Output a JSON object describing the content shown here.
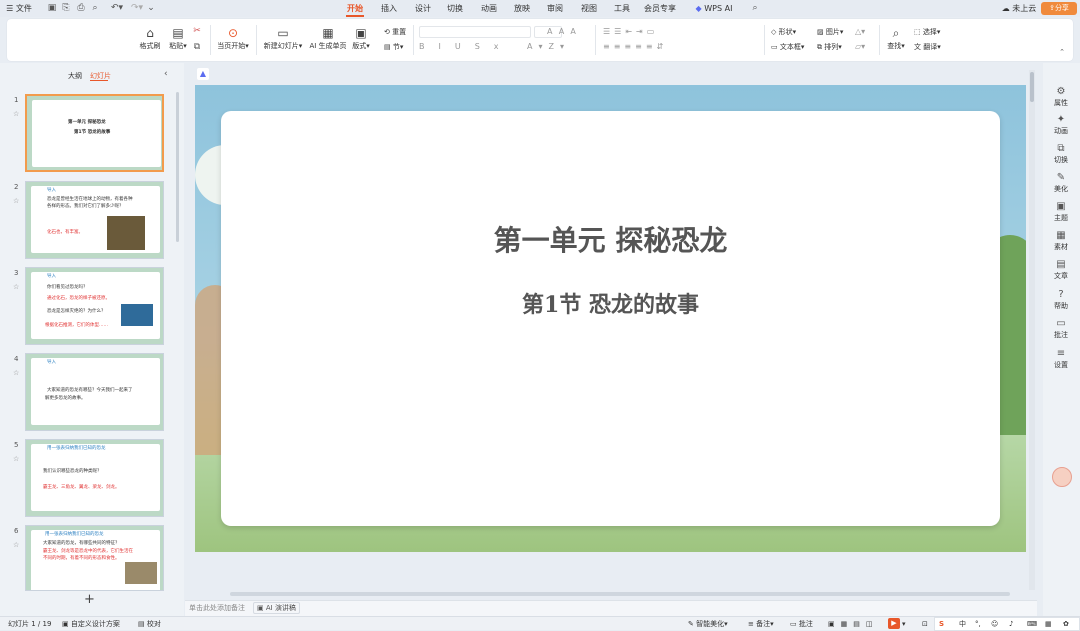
{
  "topbar": {
    "file": "文件",
    "tabs": [
      "开始",
      "插入",
      "设计",
      "切换",
      "动画",
      "放映",
      "审阅",
      "视图",
      "工具",
      "会员专享"
    ],
    "wps_ai": "WPS AI",
    "cloud": "未上云",
    "share": "分享"
  },
  "ribbon": {
    "format_painter": "格式刷",
    "paste": "粘贴",
    "from_current": "当页开始",
    "new_slide": "新建幻灯片",
    "ai_generate": "AI 生成单页",
    "layout": "版式",
    "reset": "重置",
    "section": "节",
    "shape": "形状",
    "picture": "图片",
    "textbox": "文本框",
    "arrange": "排列",
    "find": "查找",
    "select": "选择",
    "translate": "翻译"
  },
  "leftpanel": {
    "tab_outline": "大纲",
    "tab_slides": "幻灯片",
    "thumbnails": [
      {
        "num": "1",
        "lines": [
          "第一单元  探秘恐龙",
          "第1节  恐龙的故事"
        ]
      },
      {
        "num": "2",
        "lines": [
          "导入",
          "恐龙是曾经生活在地球上的动物，有着各种",
          "各样的形态。我们对它们了解多少呢？",
          "",
          "化石也，有丰富。"
        ]
      },
      {
        "num": "3",
        "lines": [
          "导入",
          "你们看见过恐龙吗？",
          "通过化石，恐龙的样子被还原。",
          "恐龙是怎样灭绝的？为什么？",
          "根据化石推测，它们的体型……"
        ]
      },
      {
        "num": "4",
        "lines": [
          "导入",
          "",
          "大家知道的恐龙有哪些？今天我们一起来了",
          "解更多恐龙的故事。"
        ]
      },
      {
        "num": "5",
        "lines": [
          "用一张表归纳我们已知的恐龙",
          "",
          "我们认识哪些恐龙的种类呢？",
          "霸王龙、三角龙、翼龙、梁龙、剑龙。"
        ]
      },
      {
        "num": "6",
        "lines": [
          "用一张表归纳我们已知的恐龙",
          "大家知道的恐龙，有哪些共同的特征？",
          "霸王龙、剑龙等是恐龙中的代表，它们生活在",
          "不同的时期，有着不同的形态和食性。"
        ]
      }
    ],
    "add": "+"
  },
  "slide": {
    "title": "第一单元  探秘恐龙",
    "subtitle": "第1节  恐龙的故事"
  },
  "rightbar": [
    "属性",
    "动画",
    "切换",
    "美化",
    "主题",
    "素材",
    "文章",
    "帮助",
    "批注",
    "设置"
  ],
  "notes": {
    "placeholder": "单击此处添加备注",
    "ai_speech": "AI 演讲稿"
  },
  "status": {
    "slide_count": "幻灯片 1 / 19",
    "custom_design": "自定义设计方案",
    "proofread": "校对",
    "smart_beautify": "智能美化",
    "notes": "备注",
    "comments": "批注"
  },
  "ime": [
    "S",
    "中",
    "°,",
    "☺",
    "♪",
    "⌨",
    "▦",
    "✿"
  ]
}
